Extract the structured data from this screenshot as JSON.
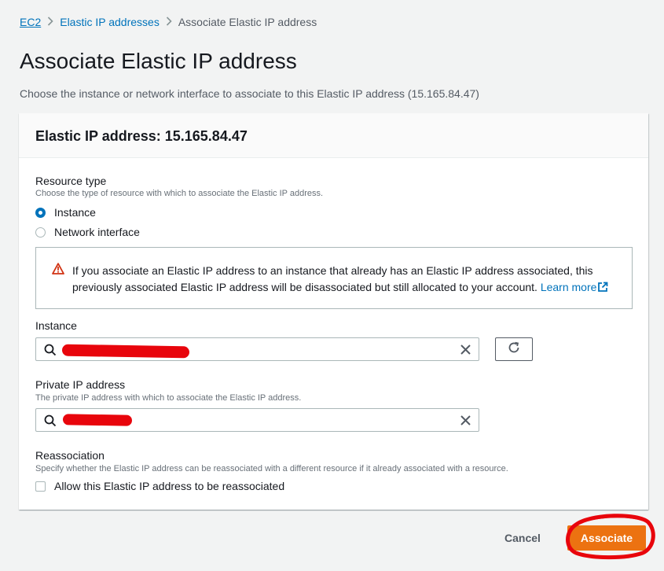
{
  "breadcrumb": {
    "items": [
      "EC2",
      "Elastic IP addresses",
      "Associate Elastic IP address"
    ]
  },
  "page": {
    "title": "Associate Elastic IP address",
    "description": "Choose the instance or network interface to associate to this Elastic IP address (15.165.84.47)"
  },
  "panel": {
    "title": "Elastic IP address: 15.165.84.47"
  },
  "resource_type": {
    "label": "Resource type",
    "hint": "Choose the type of resource with which to associate the Elastic IP address.",
    "options": [
      "Instance",
      "Network interface"
    ],
    "selected": "Instance"
  },
  "alert": {
    "text": "If you associate an Elastic IP address to an instance that already has an Elastic IP address associated, this previously associated Elastic IP address will be disassociated but still allocated to your account.",
    "link": "Learn more"
  },
  "instance": {
    "label": "Instance",
    "value": ""
  },
  "private_ip": {
    "label": "Private IP address",
    "hint": "The private IP address with which to associate the Elastic IP address.",
    "value": ""
  },
  "reassociation": {
    "label": "Reassociation",
    "hint": "Specify whether the Elastic IP address can be reassociated with a different resource if it already associated with a resource.",
    "checkbox_label": "Allow this Elastic IP address to be reassociated",
    "checked": false
  },
  "actions": {
    "cancel": "Cancel",
    "associate": "Associate"
  },
  "colors": {
    "link": "#0073bb",
    "primary_button": "#ec7211",
    "warning": "#d13212",
    "annotation": "#e8050c"
  }
}
